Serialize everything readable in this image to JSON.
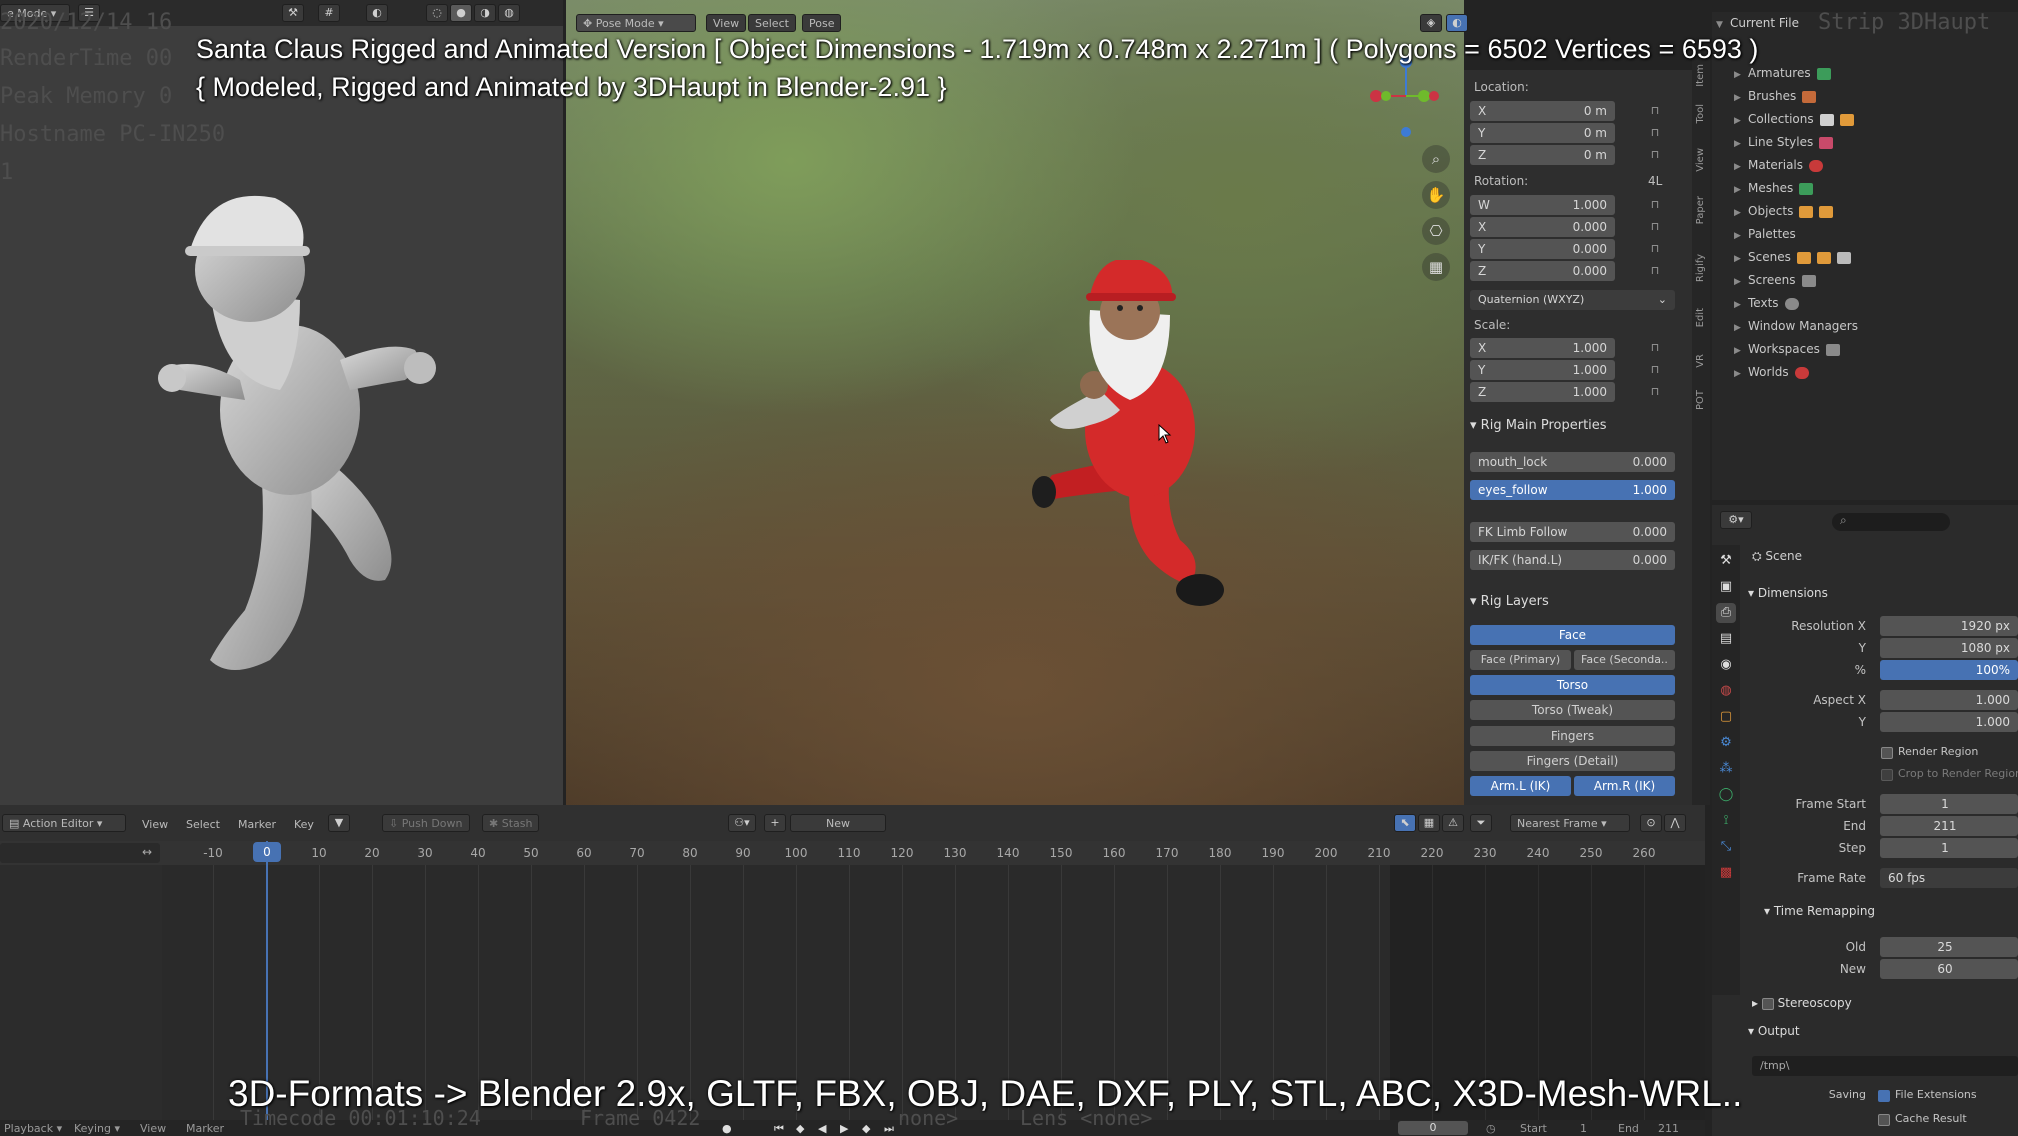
{
  "overlay": {
    "title_line1": "Santa Claus Rigged and Animated Version [ Object Dimensions -  1.719m x 0.748m x 2.271m ] ( Polygons = 6502  Vertices = 6593 )",
    "title_line2": "{ Modeled, Rigged and Animated by 3DHaupt in Blender-2.91 }",
    "bottom_line": "3D-Formats -> Blender 2.9x, GLTF, FBX, OBJ, DAE, DXF, PLY, STL, ABC, X3D-Mesh-WRL..",
    "stats_date": "2020/12/14 16",
    "stats_render_time": "RenderTime 00",
    "stats_peak_memory": "Peak Memory 0",
    "stats_hostname": "Hostname PC-IN250",
    "stats_one": "1",
    "stats_timecode": "Timecode 00:01:10:24",
    "stats_frame": "Frame 0422",
    "stats_none": "none>",
    "stats_lens": "Lens <none>",
    "stats_strip": "Strip 3DHaupt"
  },
  "left_editor": {
    "mode_label": "e Mode"
  },
  "viewport": {
    "mode": "Pose Mode",
    "menus": [
      "View",
      "Select",
      "Pose"
    ]
  },
  "npanel": {
    "location_label": "Location:",
    "location": [
      {
        "k": "X",
        "v": "0 m"
      },
      {
        "k": "Y",
        "v": "0 m"
      },
      {
        "k": "Z",
        "v": "0 m"
      }
    ],
    "rotation_label": "Rotation:",
    "rotation_mode_short": "4L",
    "rotation": [
      {
        "k": "W",
        "v": "1.000"
      },
      {
        "k": "X",
        "v": "0.000"
      },
      {
        "k": "Y",
        "v": "0.000"
      },
      {
        "k": "Z",
        "v": "0.000"
      }
    ],
    "rotation_mode": "Quaternion (WXYZ)",
    "scale_label": "Scale:",
    "scale": [
      {
        "k": "X",
        "v": "1.000"
      },
      {
        "k": "Y",
        "v": "1.000"
      },
      {
        "k": "Z",
        "v": "1.000"
      }
    ],
    "rig_main_title": "Rig Main Properties",
    "rig_main": [
      {
        "k": "mouth_lock",
        "v": "0.000"
      },
      {
        "k": "eyes_follow",
        "v": "1.000"
      },
      {
        "k": "FK Limb Follow",
        "v": "0.000"
      },
      {
        "k": "IK/FK (hand.L)",
        "v": "0.000"
      }
    ],
    "rig_layers_title": "Rig Layers",
    "rig_layers": {
      "face": "Face",
      "face_primary": "Face (Primary)",
      "face_secondary": "Face (Seconda..",
      "torso": "Torso",
      "torso_tweak": "Torso (Tweak)",
      "fingers": "Fingers",
      "fingers_detail": "Fingers (Detail)",
      "arm_l_ik": "Arm.L (IK)",
      "arm_r_ik": "Arm.R (IK)"
    },
    "tabs": [
      "Item",
      "Tool",
      "View",
      "Paper",
      "Rigify",
      "Edit",
      "VR",
      "POT"
    ]
  },
  "outliner": {
    "root": "Current File",
    "items": [
      "Armatures",
      "Brushes",
      "Collections",
      "Line Styles",
      "Materials",
      "Meshes",
      "Objects",
      "Palettes",
      "Scenes",
      "Screens",
      "Texts",
      "Window Managers",
      "Workspaces",
      "Worlds"
    ]
  },
  "properties": {
    "scene_label": "Scene",
    "dimensions_title": "Dimensions",
    "resolution_x_label": "Resolution X",
    "resolution_x": "1920 px",
    "y_label": "Y",
    "resolution_y": "1080 px",
    "pct_label": "%",
    "resolution_pct": "100%",
    "aspect_x_label": "Aspect X",
    "aspect_x": "1.000",
    "aspect_y": "1.000",
    "render_region": "Render Region",
    "crop_region": "Crop to Render Region",
    "frame_start_label": "Frame Start",
    "frame_start": "1",
    "end_label": "End",
    "frame_end": "211",
    "step_label": "Step",
    "frame_step": "1",
    "frame_rate_label": "Frame Rate",
    "frame_rate": "60 fps",
    "time_remapping": "Time Remapping",
    "old_label": "Old",
    "old_val": "25",
    "new_label": "New",
    "new_val": "60",
    "stereoscopy": "Stereoscopy",
    "output_title": "Output",
    "output_path": "/tmp\\",
    "saving_label": "Saving",
    "file_extensions": "File Extensions",
    "cache_result": "Cache Result"
  },
  "timeline": {
    "editor_type": "Action Editor",
    "menus": [
      "View",
      "Select",
      "Marker",
      "Key"
    ],
    "push_down": "Push Down",
    "stash": "Stash",
    "new_btn": "New",
    "snap_mode": "Nearest Frame",
    "current_frame": "0",
    "ruler": [
      "-10",
      "0",
      "10",
      "20",
      "30",
      "40",
      "50",
      "60",
      "70",
      "80",
      "90",
      "100",
      "110",
      "120",
      "130",
      "140",
      "150",
      "160",
      "170",
      "180",
      "190",
      "200",
      "210",
      "220",
      "230",
      "240",
      "250",
      "260"
    ],
    "footer": {
      "playback": "Playback",
      "keying": "Keying",
      "view": "View",
      "marker": "Marker",
      "frame_now": "0",
      "start_label": "Start",
      "start_val": "1",
      "end_label": "End",
      "end_val": "211"
    }
  },
  "colors": {
    "accent": "#4772b3",
    "panel": "#2e2e2e",
    "field": "#545454",
    "santa_red": "#d42a2a"
  }
}
